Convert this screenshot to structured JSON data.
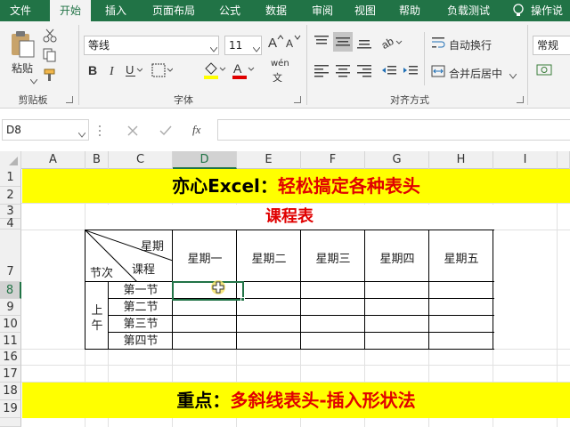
{
  "tabs": [
    "文件",
    "开始",
    "插入",
    "页面布局",
    "公式",
    "数据",
    "审阅",
    "视图",
    "帮助",
    "负载测试",
    "操作说"
  ],
  "active_tab": "开始",
  "ribbon": {
    "clipboard": {
      "paste_label": "粘贴",
      "group_label": "剪贴板"
    },
    "font": {
      "font_name": "等线",
      "font_size": "11",
      "group_label": "字体",
      "phonetic": "wén"
    },
    "alignment": {
      "wrap_text": "自动换行",
      "merge_center": "合并后居中",
      "group_label": "对齐方式"
    },
    "number": {
      "format": "常规"
    }
  },
  "formula_bar": {
    "name_box": "D8",
    "formula": "",
    "fx": "fx"
  },
  "columns": [
    "A",
    "B",
    "C",
    "D",
    "E",
    "F",
    "G",
    "H",
    "I"
  ],
  "selected_column": "D",
  "rows": [
    "1",
    "2",
    "3",
    "4",
    "7",
    "8",
    "9",
    "10",
    "11",
    "16",
    "17",
    "18",
    "19"
  ],
  "selected_row": "8",
  "sheet": {
    "banner1": {
      "black": "亦心Excel：",
      "red": "轻松搞定各种表头"
    },
    "title": "课程表",
    "header": {
      "weekday": "星期",
      "course": "课程",
      "period": "节次"
    },
    "days": [
      "星期一",
      "星期二",
      "星期三",
      "星期四",
      "星期五"
    ],
    "morning": [
      "上",
      "午"
    ],
    "sections": [
      "第一节",
      "第二节",
      "第三节",
      "第四节"
    ],
    "banner2": {
      "black": "重点：",
      "red": "多斜线表头-插入形状法"
    }
  },
  "colors": {
    "brand": "#217346",
    "banner_bg": "#ffff00",
    "accent_red": "#e00000"
  }
}
